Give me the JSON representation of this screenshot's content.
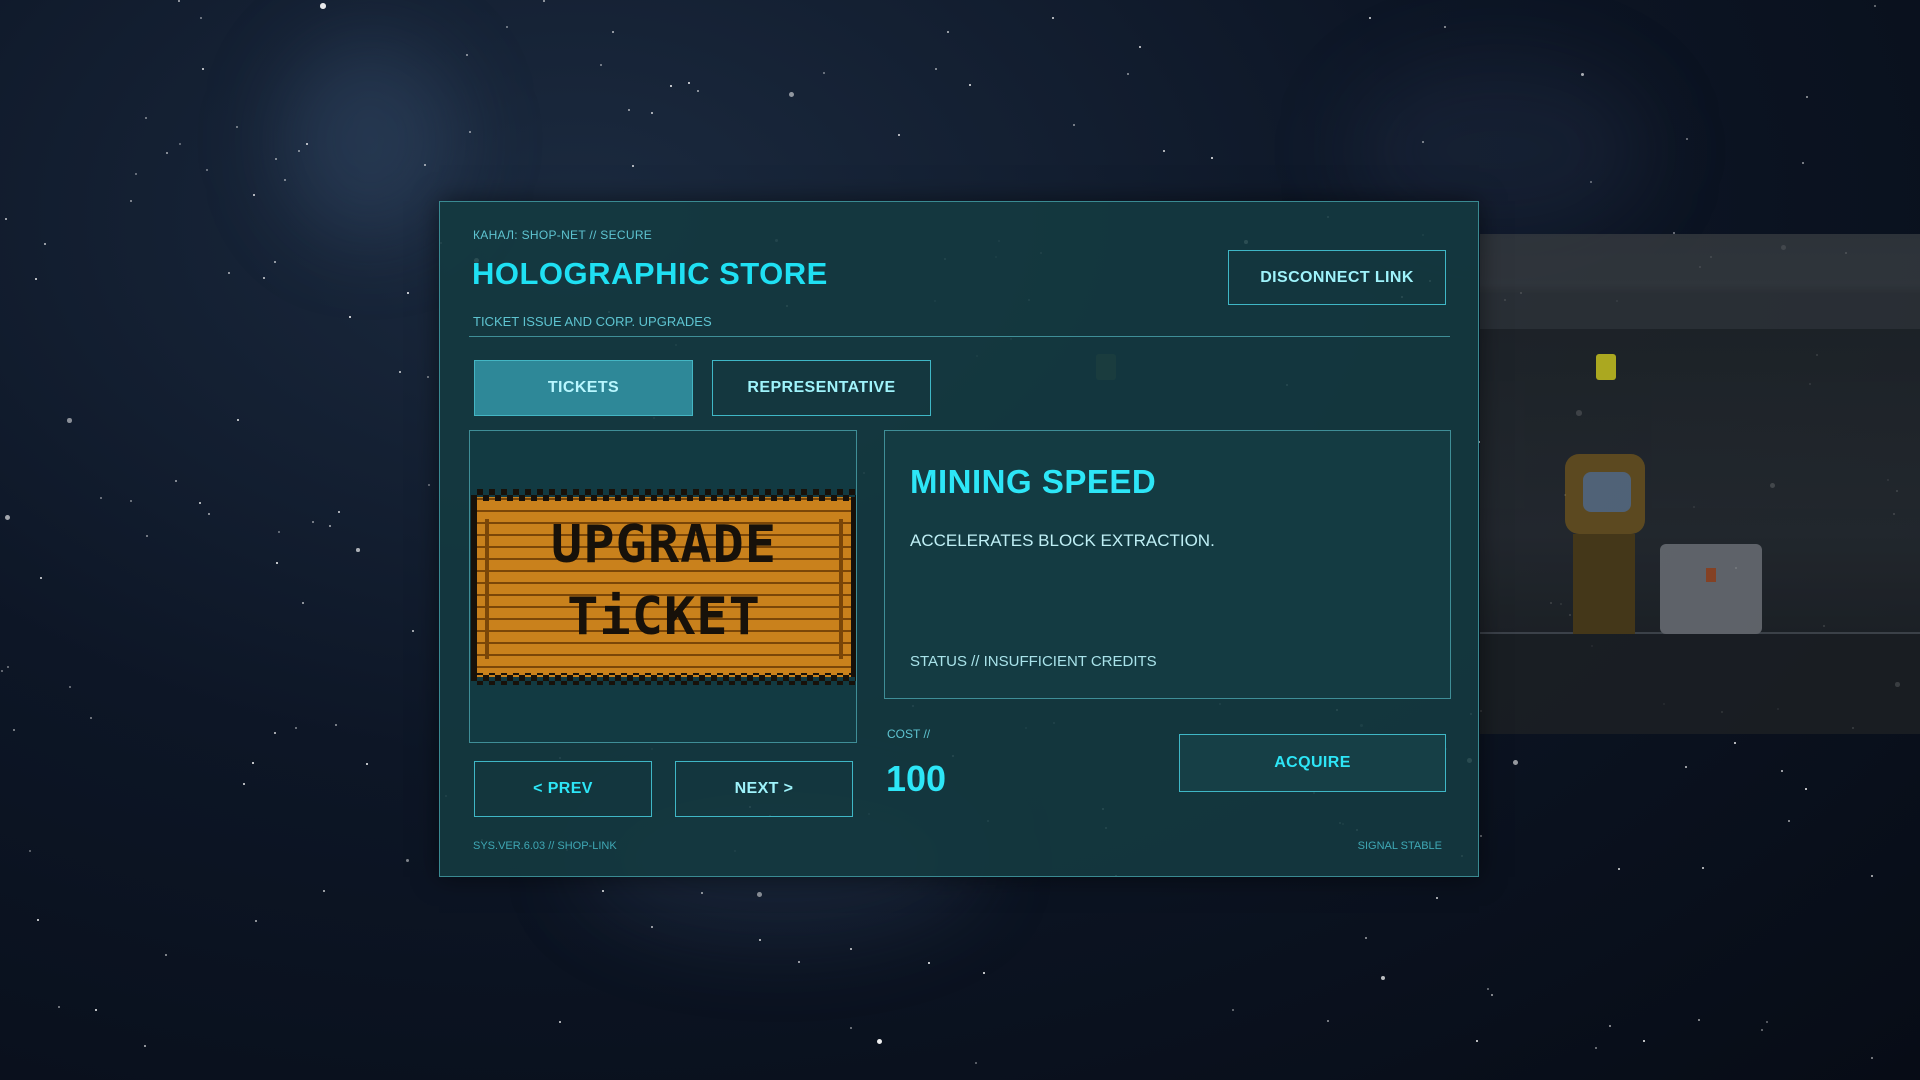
{
  "store": {
    "channel": "КАНАЛ: SHOP-NET // SECURE",
    "title": "HOLOGRAPHIC STORE",
    "subtitle": "TICKET ISSUE AND CORP. UPGRADES",
    "disconnect_label": "DISCONNECT LINK"
  },
  "tabs": [
    {
      "label": "TICKETS",
      "active": true
    },
    {
      "label": "REPRESENTATIVE",
      "active": false
    }
  ],
  "item": {
    "image_line1": "UPGRADE",
    "image_line2": "TiCKET",
    "name": "MINING SPEED",
    "description": "ACCELERATES BLOCK EXTRACTION.",
    "status": "STATUS // INSUFFICIENT CREDITS",
    "cost_label": "COST //",
    "cost_value": "100"
  },
  "nav": {
    "prev_label": "< PREV",
    "next_label": "NEXT >"
  },
  "actions": {
    "acquire_label": "ACQUIRE"
  },
  "footer": {
    "version": "SYS.VER.6.03 // SHOP-LINK",
    "signal": "SIGNAL STABLE"
  },
  "colors": {
    "accent": "#2de6f7",
    "panel": "#143a40",
    "border": "#3f8e97",
    "ticket": "#c9811c"
  }
}
